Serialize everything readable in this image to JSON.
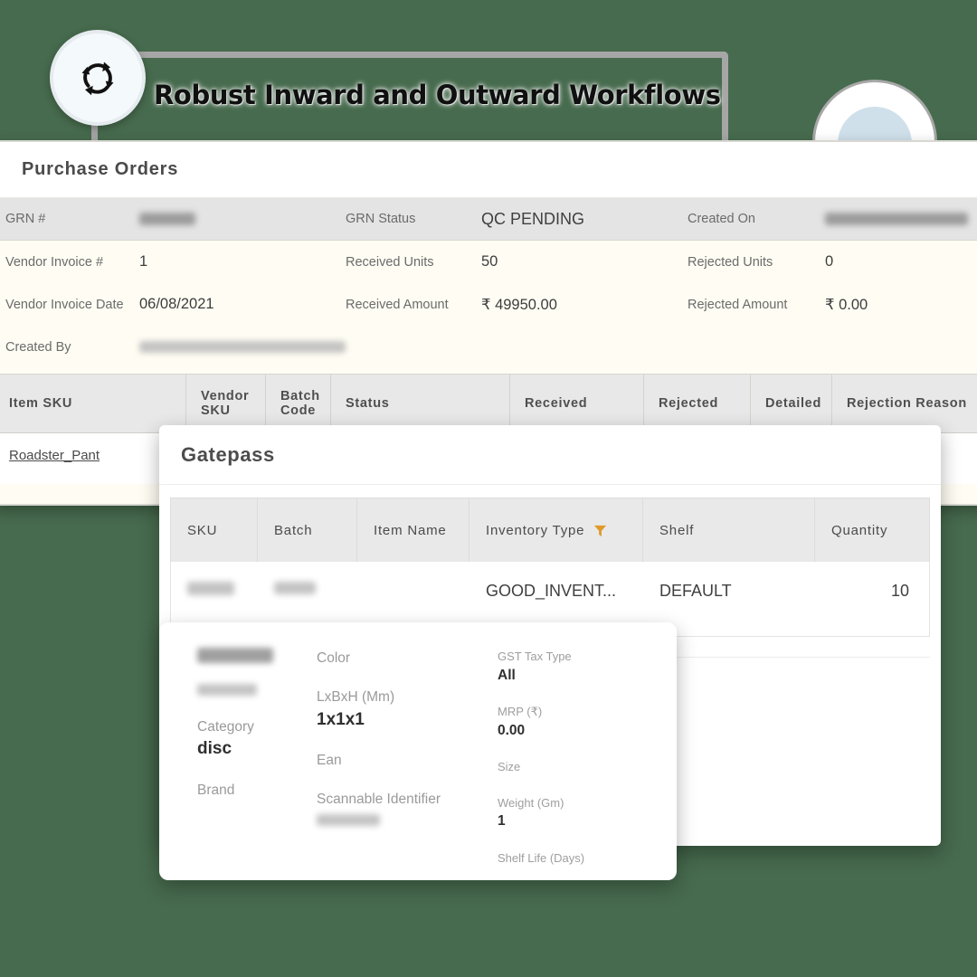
{
  "banner": {
    "title": "Robust Inward and Outward Workflows",
    "badge_icon": "sync-rotate-icon"
  },
  "purchase_orders": {
    "panel_title": "Purchase Orders",
    "summary": {
      "row1": [
        {
          "label": "GRN #",
          "value": "",
          "redacted": true,
          "redact_w": 62
        },
        {
          "label": "GRN Status",
          "value": "QC  PENDING",
          "redacted": false
        },
        {
          "label": "Created On",
          "value": "",
          "redacted": true,
          "redact_w": 158
        }
      ],
      "row2": [
        {
          "label": "Vendor Invoice #",
          "value": "1"
        },
        {
          "label": "Received Units",
          "value": "50"
        },
        {
          "label": "Rejected Units",
          "value": "0"
        }
      ],
      "row3": [
        {
          "label": "Vendor Invoice Date",
          "value": "06/08/2021"
        },
        {
          "label": "Received Amount",
          "value": "₹ 49950.00"
        },
        {
          "label": "Rejected Amount",
          "value": "₹ 0.00"
        }
      ],
      "row4": [
        {
          "label": "Created By",
          "value": "",
          "redacted": true,
          "redact_w": 228
        }
      ]
    },
    "table": {
      "columns": [
        "Item SKU",
        "Vendor SKU",
        "Batch Code",
        "Status",
        "Received",
        "Rejected",
        "Detailed",
        "Rejection Reason"
      ],
      "rows": [
        {
          "item_sku": "Roadster_Pant"
        }
      ]
    }
  },
  "gatepass": {
    "panel_title": "Gatepass",
    "table": {
      "columns": [
        "SKU",
        "Batch",
        "Item Name",
        "Inventory Type",
        "Shelf",
        "Quantity"
      ],
      "filter_column": "Inventory Type",
      "filter_icon": "funnel-filter-icon",
      "rows": [
        {
          "sku": "",
          "batch": "",
          "item_name": "GOOD_INVENT...",
          "inventory_type": "",
          "shelf": "DEFAULT",
          "quantity": "10"
        }
      ]
    }
  },
  "detail_card": {
    "col_a": [
      {
        "label": "",
        "value": "",
        "redacted": true,
        "redact_w": 84,
        "redact_h": 17
      },
      {
        "label": "",
        "value": "",
        "redacted": true,
        "redact_w": 66,
        "redact_h": 13
      },
      {
        "label": "Category",
        "value": "disc"
      },
      {
        "label": "Brand",
        "value": ""
      }
    ],
    "col_b": [
      {
        "label": "Color",
        "value": ""
      },
      {
        "label": "LxBxH (Mm)",
        "value": "1x1x1"
      },
      {
        "label": "Ean",
        "value": ""
      },
      {
        "label": "Scannable Identifier",
        "value": "",
        "redacted": true,
        "redact_w": 70,
        "redact_h": 13
      }
    ],
    "col_c": [
      {
        "label": "GST Tax Type",
        "value": "All"
      },
      {
        "label": "MRP (₹)",
        "value": "0.00"
      },
      {
        "label": "Size",
        "value": ""
      },
      {
        "label": "Weight (Gm)",
        "value": "1"
      },
      {
        "label": "Shelf Life (Days)",
        "value": ""
      }
    ]
  },
  "colors": {
    "background": "#476b4e",
    "panel_cream": "#fffdf3",
    "header_grey": "#e4e4e4",
    "accent_blue": "#cfe0ea",
    "bracket_grey": "#a6a6a6"
  }
}
